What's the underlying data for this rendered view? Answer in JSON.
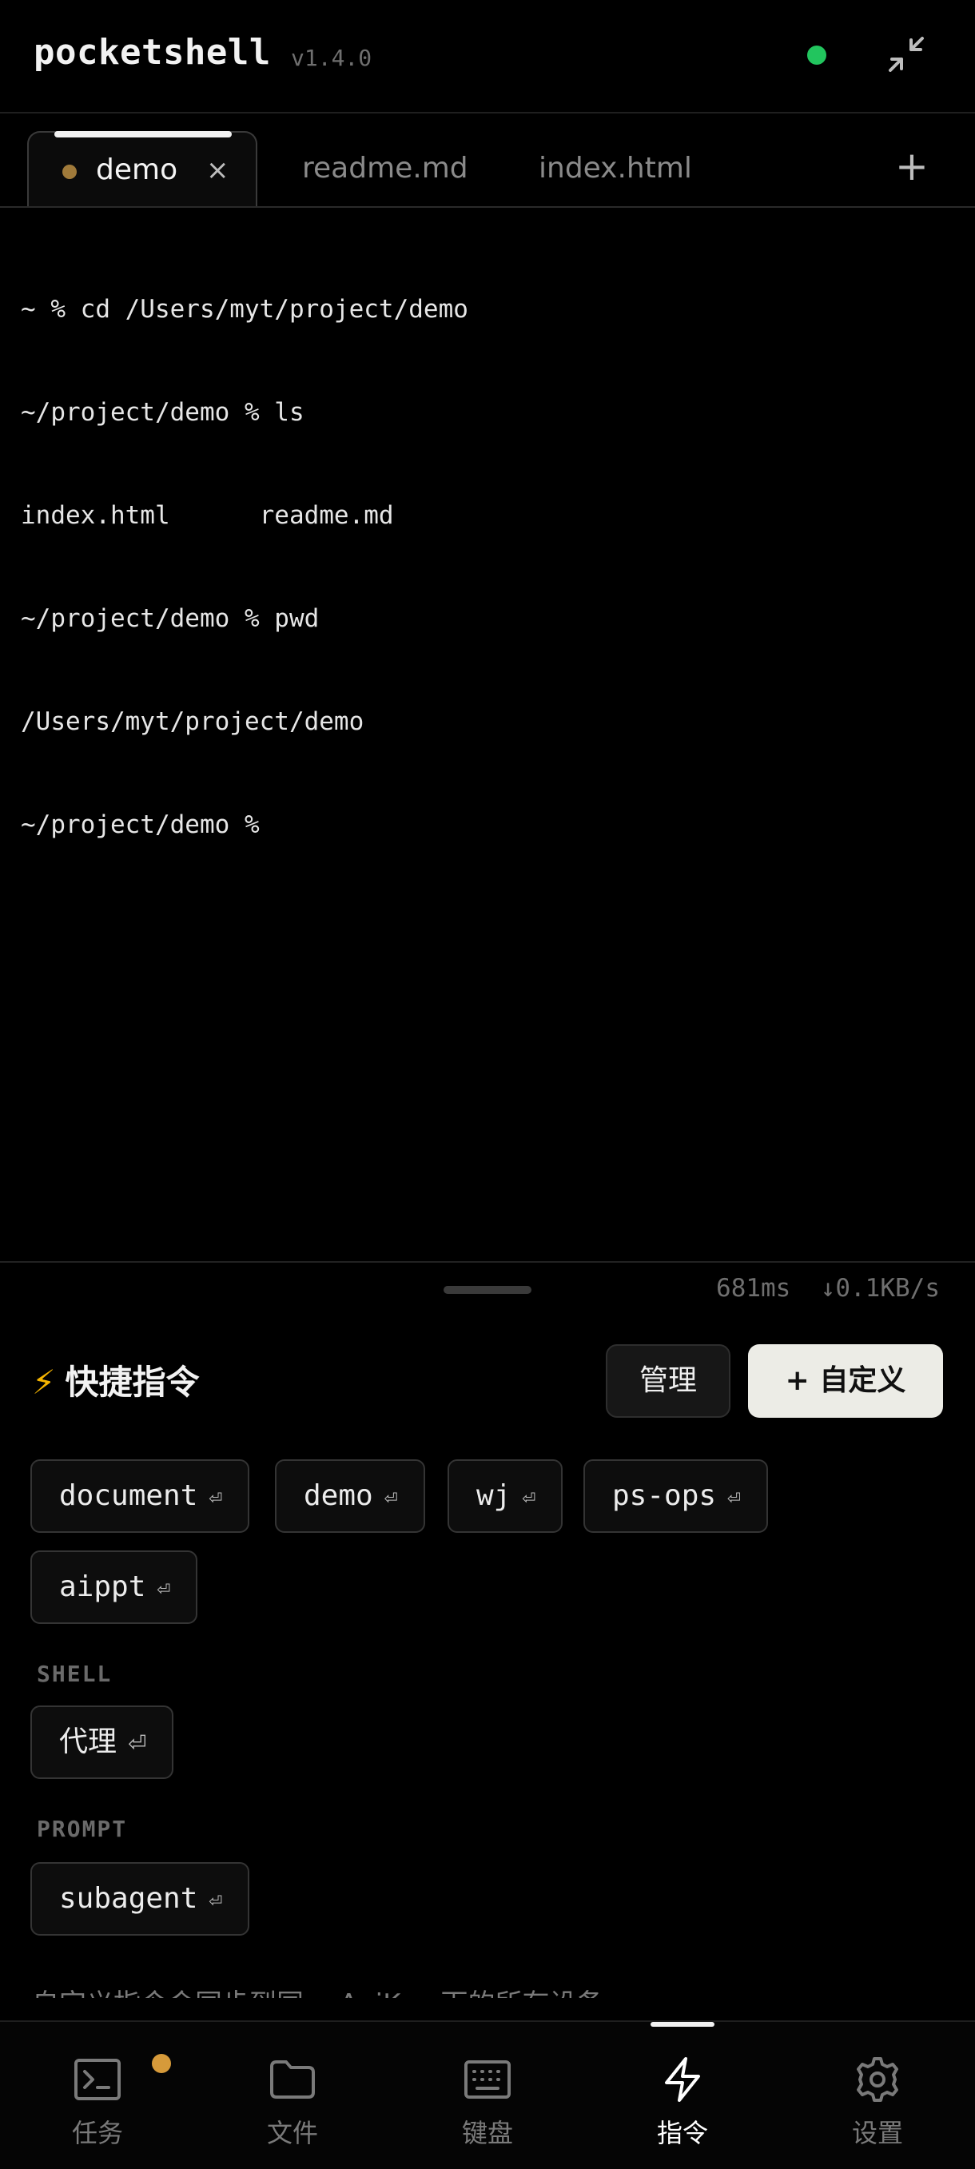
{
  "header": {
    "title": "pocketshell",
    "version": "v1.4.0",
    "status_color": "#22c55e",
    "collapse_icon": "collapse-icon"
  },
  "tabs": [
    {
      "label": "demo",
      "active": true,
      "close": "×"
    },
    {
      "label": "readme.md"
    },
    {
      "label": "index.html"
    }
  ],
  "add_tab": "+",
  "terminal": {
    "lines": [
      "~ % cd /Users/myt/project/demo",
      "~/project/demo % ls",
      "index.html      readme.md",
      "~/project/demo % pwd",
      "/Users/myt/project/demo",
      "~/project/demo %"
    ]
  },
  "stats": {
    "latency": "681ms",
    "speed": "↓0.1KB/s"
  },
  "quick_commands": {
    "title": "快捷指令",
    "manage_label": "管理",
    "custom_label": "+ 自定义",
    "enter_glyph": "⏎",
    "chips": [
      "document",
      "demo",
      "wj",
      "ps-ops",
      "aippt"
    ],
    "sections": [
      {
        "label": "SHELL",
        "chips": [
          "代理"
        ]
      },
      {
        "label": "PROMPT",
        "chips": [
          "subagent"
        ]
      }
    ],
    "footer_note": "自定义指令会同步到同一 ApiKey 下的所有设备"
  },
  "nav": [
    {
      "label": "任务",
      "icon": "terminal-icon",
      "badge": true
    },
    {
      "label": "文件",
      "icon": "folder-icon"
    },
    {
      "label": "键盘",
      "icon": "keyboard-icon"
    },
    {
      "label": "指令",
      "icon": "lightning-icon",
      "active": true
    },
    {
      "label": "设置",
      "icon": "settings-icon"
    }
  ]
}
